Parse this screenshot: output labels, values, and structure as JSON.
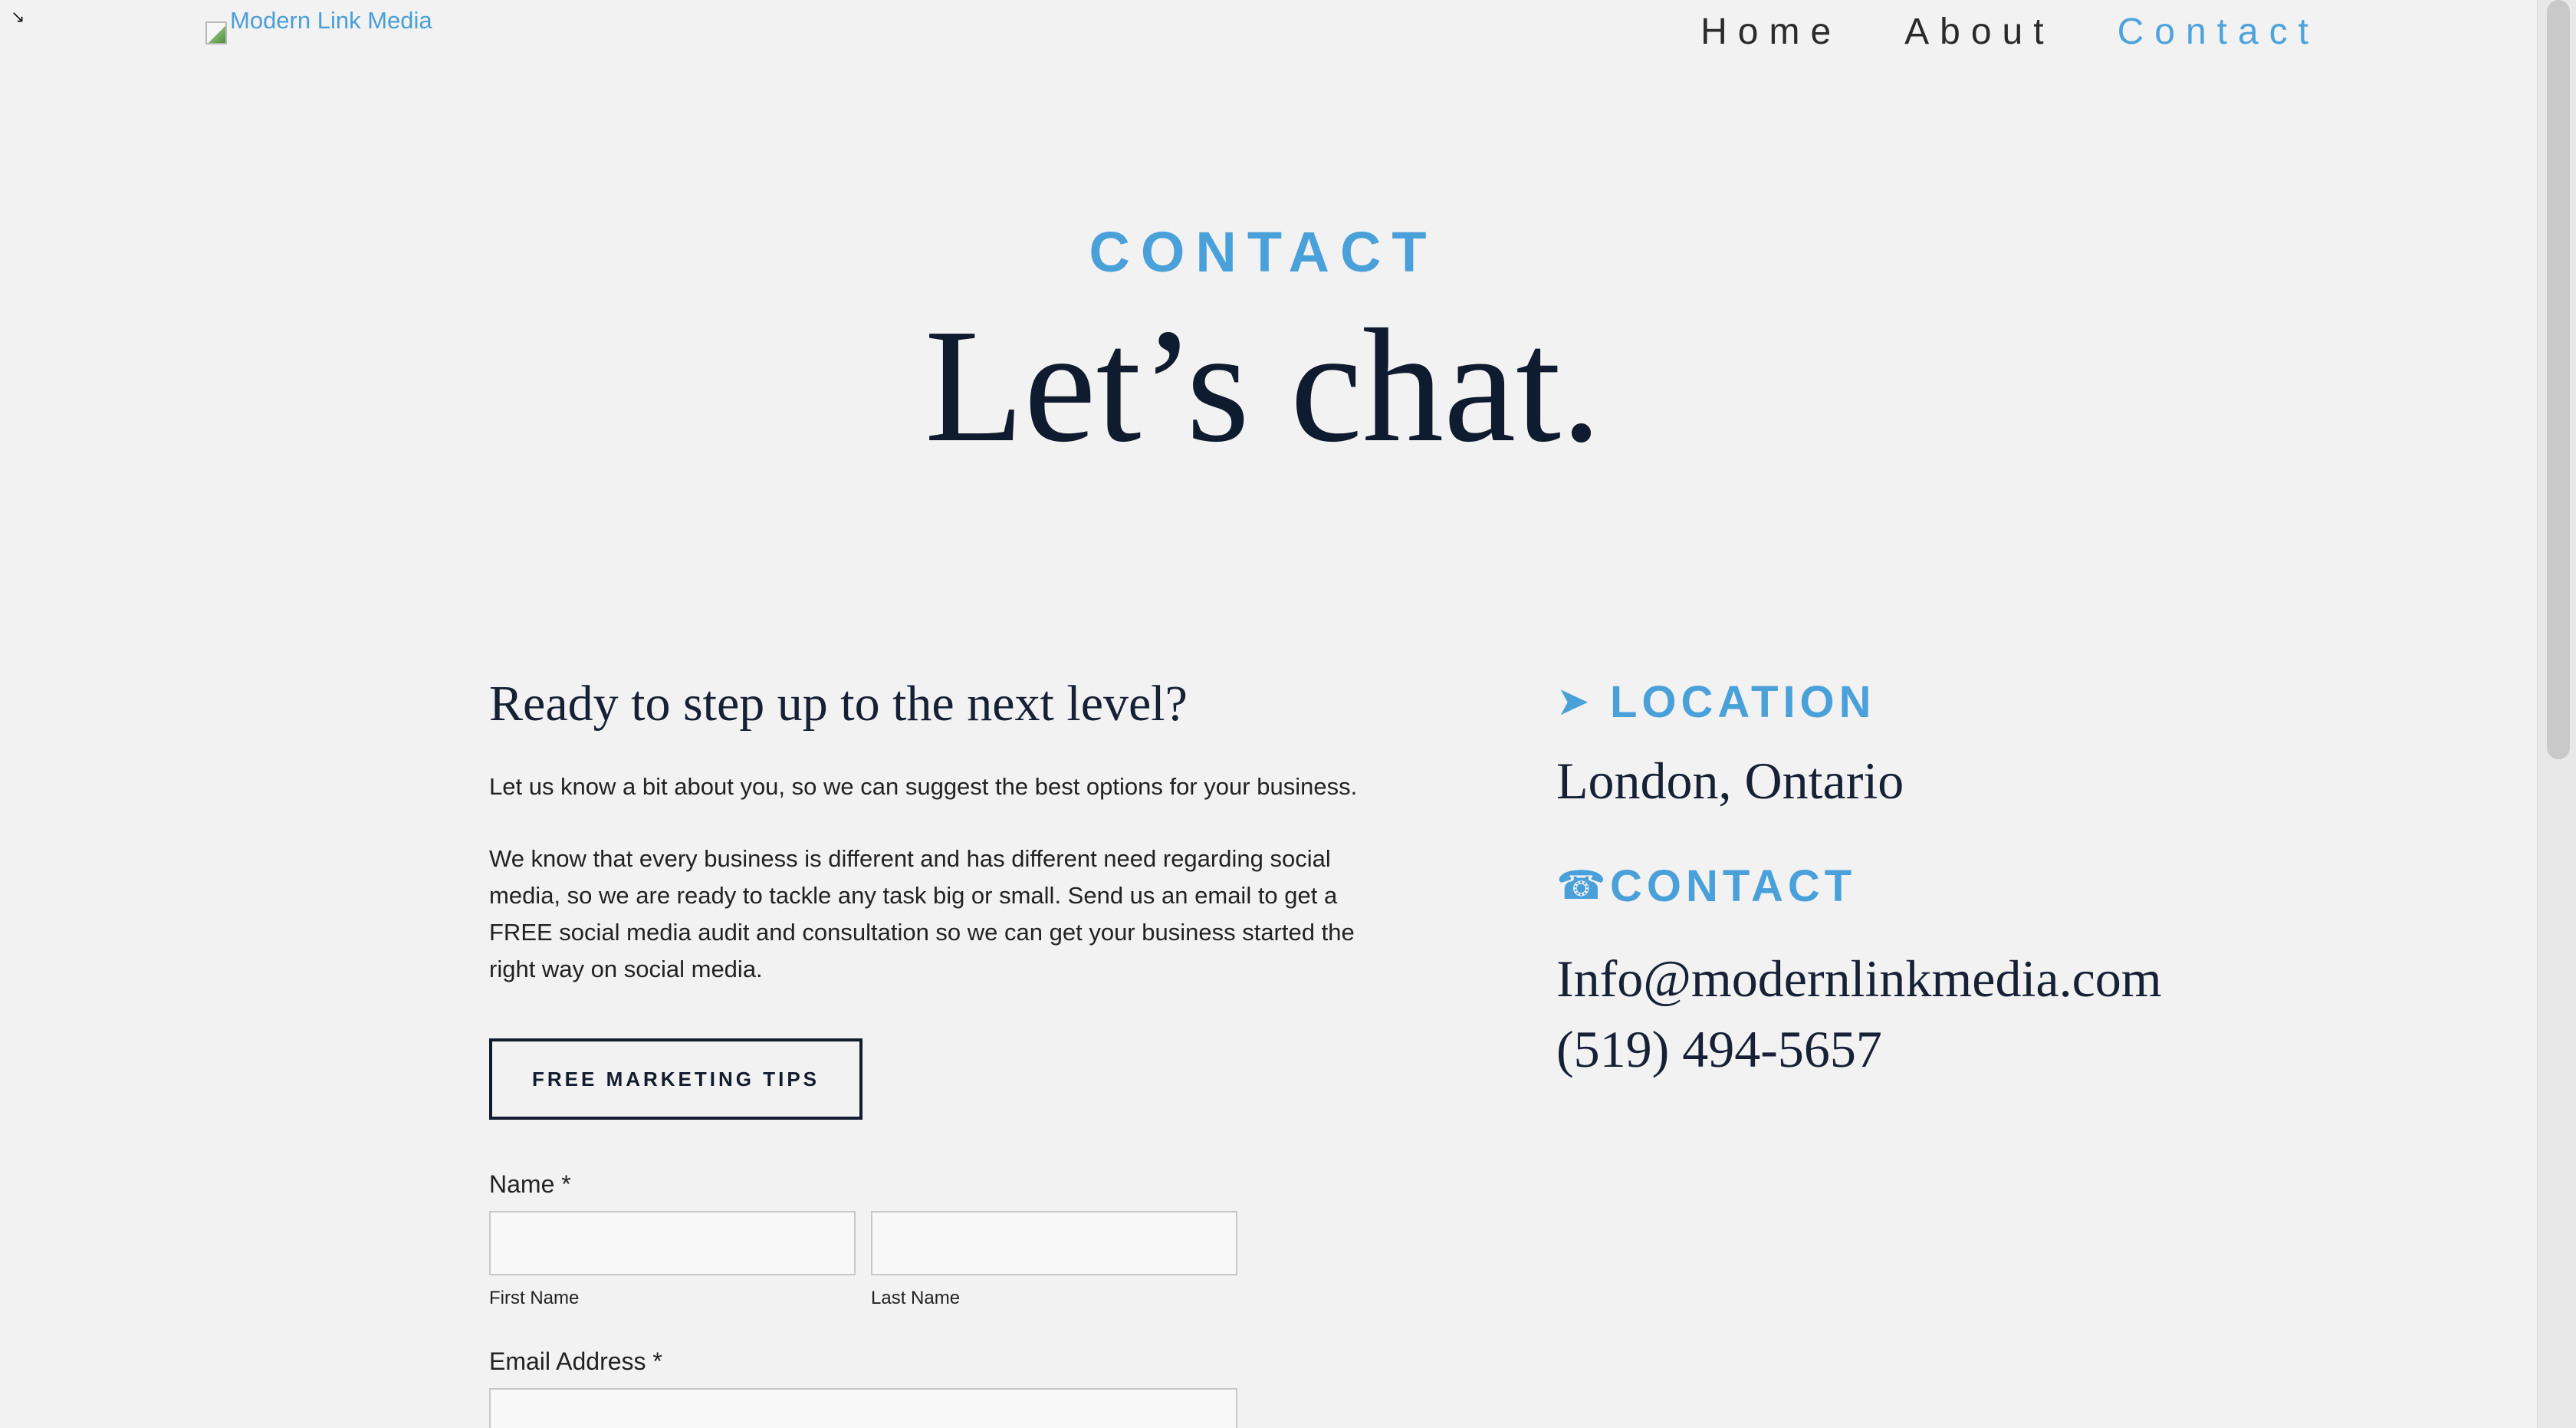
{
  "corner": {
    "icon": "resize-arrow-icon",
    "glyph": "↘"
  },
  "header": {
    "logo_text": "Modern Link Media",
    "nav": [
      {
        "label": "Home",
        "active": false
      },
      {
        "label": "About",
        "active": false
      },
      {
        "label": "Contact",
        "active": true
      }
    ]
  },
  "hero": {
    "eyebrow": "CONTACT",
    "title": "Let’s chat."
  },
  "intro": {
    "heading": "Ready to step up to the next level?",
    "paragraph1": "Let us know a bit about you, so we can suggest the best options for your business.",
    "paragraph2": "We know that every business is different and has different need regarding social media, so we are ready to tackle any task big or small. Send us an email to get a FREE social media audit and consultation so we can get your business started the right way on social media.",
    "button_label": "FREE MARKETING TIPS"
  },
  "form": {
    "name_label": "Name *",
    "first_name_sublabel": "First Name",
    "last_name_sublabel": "Last Name",
    "first_name_value": "",
    "last_name_value": "",
    "email_label": "Email Address *",
    "email_value": ""
  },
  "info": {
    "location_icon": "location-arrow-icon",
    "location_glyph": "➤",
    "location_heading": "LOCATION",
    "location_value": "London, Ontario",
    "contact_icon": "phone-icon",
    "contact_glyph": "☎",
    "contact_heading": "CONTACT",
    "email": "Info@modernlinkmedia.com",
    "phone": "(519) 494-5657"
  },
  "colors": {
    "accent": "#4aa0d9",
    "heading": "#0f1b2e",
    "background": "#f2f2f2"
  }
}
